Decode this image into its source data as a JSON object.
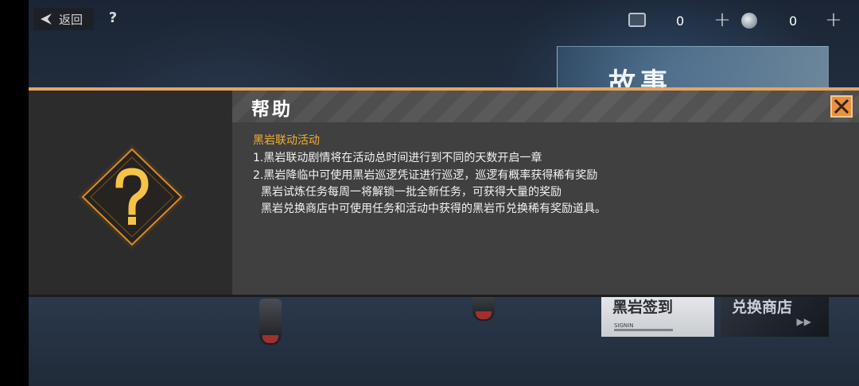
{
  "top_bar": {
    "back_label": "返回",
    "help_label": "?",
    "ticket_count": "0",
    "coin_count": "0",
    "plus_symbol": "+"
  },
  "background": {
    "story_banner": "故事",
    "signin_card": {
      "title": "黑岩签到",
      "subtitle": "SIGNIN"
    },
    "shop_card": {
      "title": "兑换商店",
      "icon": "▶▶"
    }
  },
  "modal": {
    "title": "帮助",
    "icon": "question-icon",
    "section_title": "黑岩联动活动",
    "lines": [
      "1.黑岩联动剧情将在活动总时间进行到不同的天数开启一章",
      "2.黑岩降临中可使用黑岩巡逻凭证进行巡逻，巡逻有概率获得稀有奖励",
      "黑岩试炼任务每周一将解锁一批全新任务，可获得大量的奖励",
      "黑岩兑换商店中可使用任务和活动中获得的黑岩币兑换稀有奖励道具。"
    ]
  },
  "colors": {
    "accent": "#e8a55c",
    "section_title": "#f0b132",
    "close_button": "#e8913f"
  }
}
